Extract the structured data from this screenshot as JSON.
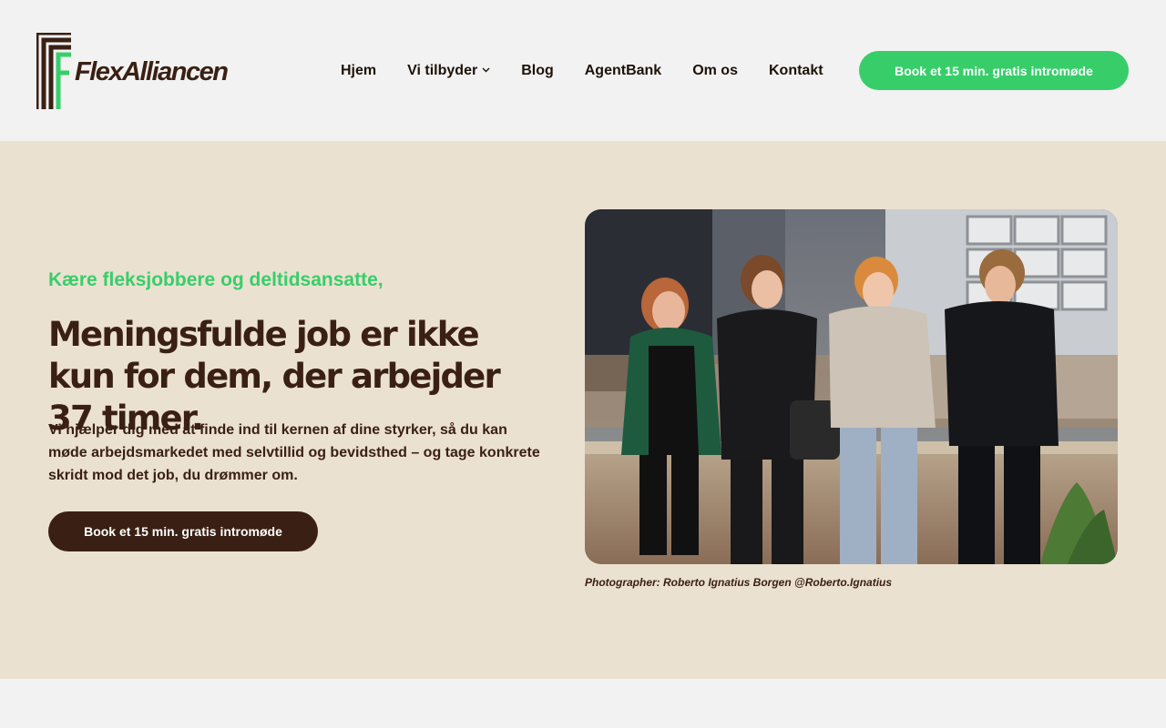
{
  "header": {
    "logo_text": "FlexAlliancen",
    "nav": [
      {
        "label": "Hjem"
      },
      {
        "label": "Vi tilbyder",
        "has_dropdown": true
      },
      {
        "label": "Blog"
      },
      {
        "label": "AgentBank"
      },
      {
        "label": "Om os"
      },
      {
        "label": "Kontakt"
      }
    ],
    "cta_label": "Book et 15 min. gratis intromøde"
  },
  "hero": {
    "greeting": "Kære fleksjobbere og deltidsansatte,",
    "headline": "Meningsfulde job er ikke kun for dem, der arbejder 37 timer.",
    "body": "Vi hjælper dig med at finde ind til kernen af dine styrker, så du kan møde arbejdsmarkedet med selvtillid og bevidsthed – og tage konkrete skridt mod det job, du drømmer om.",
    "cta_label": "Book et 15 min. gratis intromøde",
    "photo_caption": "Photographer: Roberto Ignatius Borgen @Roberto.Ignatius"
  },
  "colors": {
    "accent_green": "#37ce6a",
    "brand_brown": "#3a2014",
    "hero_bg": "#ebe1d0",
    "page_bg": "#f2f2f2"
  },
  "icons": {
    "dropdown": "chevron-down-icon",
    "logo": "flexalliancen-logo-icon"
  }
}
